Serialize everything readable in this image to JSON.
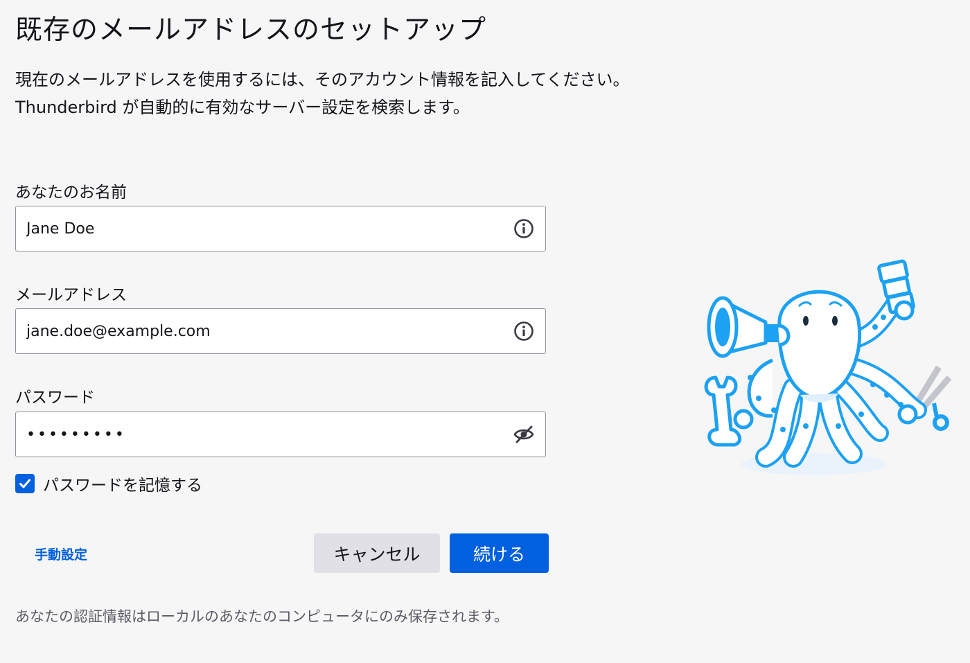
{
  "page": {
    "title": "既存のメールアドレスのセットアップ",
    "intro_line1": "現在のメールアドレスを使用するには、そのアカウント情報を記入してください。",
    "intro_line2": "Thunderbird が自動的に有効なサーバー設定を検索します。"
  },
  "form": {
    "name": {
      "label": "あなたのお名前",
      "value": "Jane Doe",
      "icon": "info-icon"
    },
    "email": {
      "label": "メールアドレス",
      "value": "jane.doe@example.com",
      "icon": "info-icon"
    },
    "password": {
      "label": "パスワード",
      "value": "•••••••••",
      "icon": "eye-slash-icon"
    },
    "remember": {
      "label": "パスワードを記憶する",
      "checked": true
    }
  },
  "actions": {
    "manual_label": "手動設定",
    "cancel_label": "キャンセル",
    "continue_label": "続ける"
  },
  "footer": {
    "note": "あなたの認証情報はローカルのあなたのコンピュータにのみ保存されます。"
  },
  "colors": {
    "accent": "#0060df",
    "background": "#f6f6f7",
    "mascot": "#1da1f2"
  }
}
